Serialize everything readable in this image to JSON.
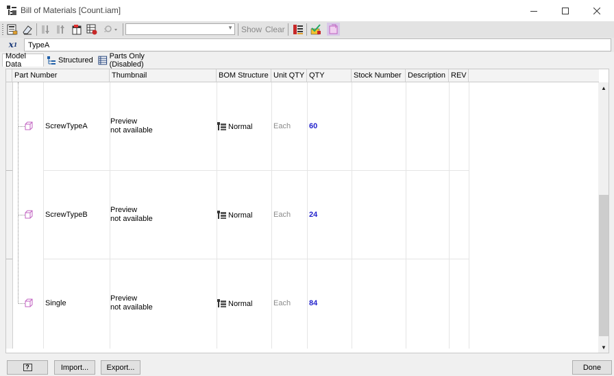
{
  "window": {
    "title": "Bill of Materials [Count.iam]"
  },
  "toolbar": {
    "show_label": "Show",
    "clear_label": "Clear",
    "filter_value": ""
  },
  "formula": {
    "value": "TypeA"
  },
  "tabs": [
    {
      "label": "Model Data",
      "icon": "",
      "active": true
    },
    {
      "label": "Structured",
      "icon": "structured-icon",
      "active": false
    },
    {
      "label": "Parts Only (Disabled)",
      "icon": "parts-only-icon",
      "active": false
    }
  ],
  "columns": [
    "Part Number",
    "Thumbnail",
    "BOM Structure",
    "Unit QTY",
    "QTY",
    "Stock Number",
    "Description",
    "REV"
  ],
  "rows": [
    {
      "part_number": "ScrewTypeA",
      "thumb_1": "Preview",
      "thumb_2": "not available",
      "bom_structure": "Normal",
      "unit_qty": "Each",
      "qty": "60",
      "stock_number": "",
      "description": "",
      "rev": ""
    },
    {
      "part_number": "ScrewTypeB",
      "thumb_1": "Preview",
      "thumb_2": "not available",
      "bom_structure": "Normal",
      "unit_qty": "Each",
      "qty": "24",
      "stock_number": "",
      "description": "",
      "rev": ""
    },
    {
      "part_number": "Single",
      "thumb_1": "Preview",
      "thumb_2": "not available",
      "bom_structure": "Normal",
      "unit_qty": "Each",
      "qty": "84",
      "stock_number": "",
      "description": "",
      "rev": ""
    }
  ],
  "footer": {
    "help_label": "?",
    "import_label": "Import...",
    "export_label": "Export...",
    "done_label": "Done"
  },
  "colors": {
    "qty_text": "#2222cc",
    "part_icon": "#c060c0",
    "accent": "#c62828"
  }
}
